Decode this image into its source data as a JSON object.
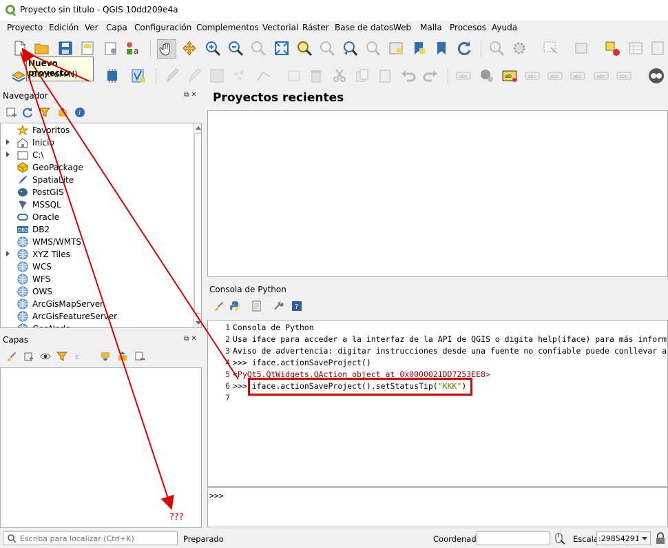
{
  "window": {
    "title": "Proyecto sin título - QGIS 10dd209e4a"
  },
  "menu": [
    "Proyecto",
    "Edición",
    "Ver",
    "Capa",
    "Configuración",
    "Complementos",
    "Vectorial",
    "Ráster",
    "Base de datos",
    "Web",
    "Malla",
    "Procesos",
    "Ayuda"
  ],
  "tooltip": {
    "title": "Nuevo proyecto",
    "shortcut": "(Control+N)"
  },
  "navigator": {
    "title": "Navegador",
    "items": [
      {
        "label": "Favoritos",
        "icon": "star-icon",
        "expandable": false
      },
      {
        "label": "Inicio",
        "icon": "home-folder-icon",
        "expandable": true
      },
      {
        "label": "C:\\",
        "icon": "drive-icon",
        "expandable": true
      },
      {
        "label": "GeoPackage",
        "icon": "geopackage-icon",
        "expandable": false
      },
      {
        "label": "SpatiaLite",
        "icon": "spatialite-icon",
        "expandable": false
      },
      {
        "label": "PostGIS",
        "icon": "postgis-icon",
        "expandable": false
      },
      {
        "label": "MSSQL",
        "icon": "mssql-icon",
        "expandable": false
      },
      {
        "label": "Oracle",
        "icon": "oracle-icon",
        "expandable": false
      },
      {
        "label": "DB2",
        "icon": "db2-icon",
        "expandable": false
      },
      {
        "label": "WMS/WMTS",
        "icon": "globe-icon",
        "expandable": false
      },
      {
        "label": "XYZ Tiles",
        "icon": "globe-icon",
        "expandable": true
      },
      {
        "label": "WCS",
        "icon": "globe-icon",
        "expandable": false
      },
      {
        "label": "WFS",
        "icon": "globe-icon",
        "expandable": false
      },
      {
        "label": "OWS",
        "icon": "globe-icon",
        "expandable": false
      },
      {
        "label": "ArcGisMapServer",
        "icon": "globe-icon",
        "expandable": false
      },
      {
        "label": "ArcGisFeatureServer",
        "icon": "globe-icon",
        "expandable": false
      },
      {
        "label": "GeoNode",
        "icon": "globe-icon",
        "expandable": false
      }
    ]
  },
  "layers": {
    "title": "Capas"
  },
  "recent": {
    "title": "Proyectos recientes"
  },
  "console": {
    "title": "Consola de Python",
    "lines": [
      {
        "n": "1",
        "text": "Consola de Python"
      },
      {
        "n": "2",
        "text": "Usa iface para acceder a la interfaz de la API de QGIS o digita help(iface) para más inform"
      },
      {
        "n": "3",
        "text": "Aviso de advertencia: digitar instrucciones desde una fuente no confiable puede conllevar a"
      },
      {
        "n": "4",
        "text": ">>> iface.actionSaveProject()"
      },
      {
        "n": "5",
        "text": "<PyQt5.QtWidgets.QAction object at 0x0000021DD7253EE8>"
      },
      {
        "n": "6",
        "prompt": ">>> ",
        "code": "iface.actionSaveProject().setStatusTip(",
        "str": "\"KKK\"",
        "close": ")"
      },
      {
        "n": "7",
        "text": ""
      }
    ],
    "input_prompt": ">>>"
  },
  "annotation": {
    "text": "???",
    "color": "#e00000"
  },
  "status": {
    "search_placeholder": "Escriba para localizar (Ctrl+K)",
    "ready": "Preparado",
    "coord_label": "Coordenada",
    "coord_value": "",
    "scale_label": "Escala",
    "scale_value": ":29854291"
  },
  "colors": {
    "accent": "#1f6fb3",
    "highlight_box": "#e00000",
    "qgis_green": "#5aa832"
  }
}
